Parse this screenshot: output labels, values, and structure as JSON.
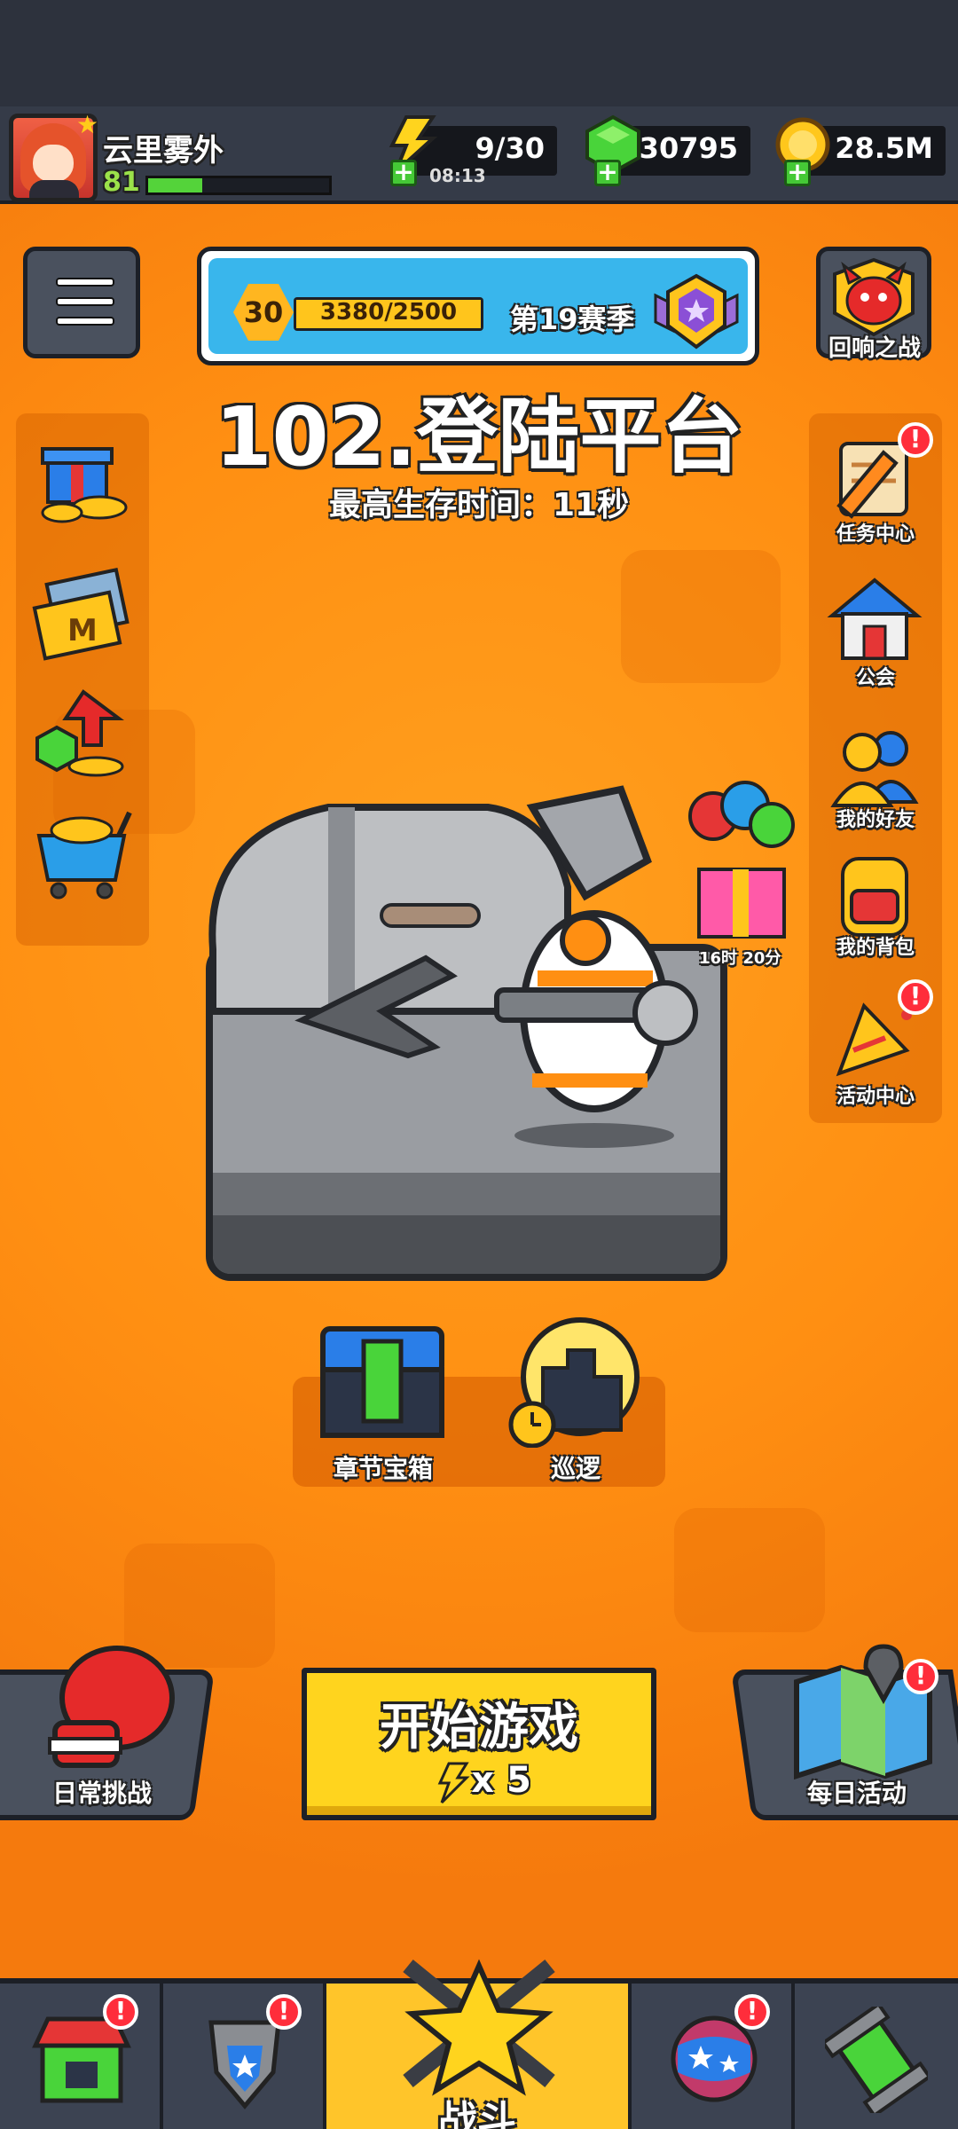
{
  "player": {
    "name": "云里雾外",
    "level": "81",
    "xp_fraction": 0.3
  },
  "resources": {
    "energy": {
      "value": "9/30",
      "timer": "08:13"
    },
    "gems": {
      "value": "30795"
    },
    "gold": {
      "value": "28.5M"
    }
  },
  "season": {
    "level": "30",
    "progress": "3380/2500",
    "progress_fraction": 1.0,
    "name": "第19赛季"
  },
  "event_battle": {
    "label": "回响之战"
  },
  "stage": {
    "title": "102.登陆平台",
    "best_survival": "最高生存时间：11秒"
  },
  "left_sidebar": {
    "items": [
      {
        "icon": "gift-gold-icon"
      },
      {
        "icon": "monthly-card-icon"
      },
      {
        "icon": "gem-growth-icon"
      },
      {
        "icon": "shop-cart-icon"
      }
    ]
  },
  "right_sidebar": {
    "items": [
      {
        "label": "任务中心",
        "icon": "quest-scroll-icon",
        "alert": "!"
      },
      {
        "label": "公会",
        "icon": "guild-house-icon"
      },
      {
        "label": "我的好友",
        "icon": "friends-icon"
      },
      {
        "label": "我的背包",
        "icon": "backpack-icon"
      },
      {
        "label": "活动中心",
        "icon": "party-horn-icon",
        "alert": "!"
      }
    ]
  },
  "gift_offer": {
    "timer": "16时 20分"
  },
  "chapter_chest": {
    "label": "章节宝箱"
  },
  "patrol": {
    "label": "巡逻"
  },
  "daily_challenge": {
    "label": "日常挑战"
  },
  "daily_activity": {
    "label": "每日活动",
    "alert": "!"
  },
  "start_button": {
    "label": "开始游戏",
    "cost": "x 5"
  },
  "nav": {
    "tabs": [
      {
        "icon": "shop-icon",
        "alert": "!"
      },
      {
        "icon": "equipment-icon",
        "alert": "!"
      },
      {
        "label": "战斗",
        "icon": "battle-star-icon",
        "active": true
      },
      {
        "icon": "planet-icon",
        "alert": "!"
      },
      {
        "icon": "talent-icon"
      }
    ]
  },
  "colors": {
    "accent_orange": "#ff8f12",
    "button_yellow": "#ffd41e",
    "alert_red": "#ff2d3b"
  }
}
